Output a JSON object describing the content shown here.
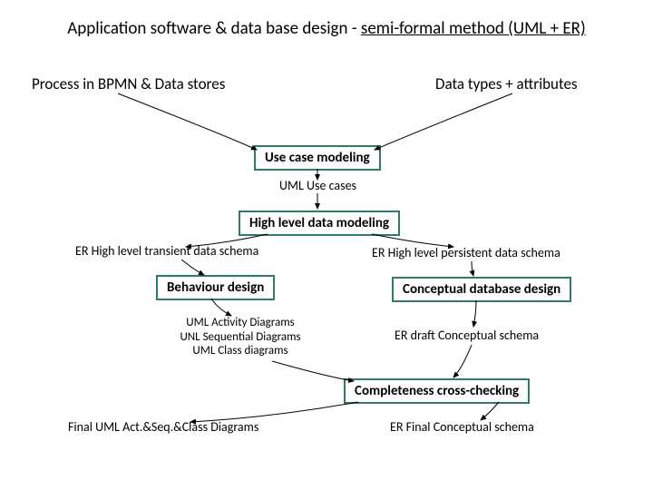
{
  "title_plain": "Application software & data base design - ",
  "title_underline": "semi-formal method (UML + ER)",
  "inputs": {
    "left": "Process in BPMN & Data stores",
    "right": "Data types + attributes"
  },
  "boxes": {
    "usecase": "Use case modeling",
    "highlevel": "High level data modeling",
    "behaviour": "Behaviour design",
    "conceptual": "Conceptual database design",
    "completeness": "Completeness cross-checking"
  },
  "labels": {
    "uml_usecases": "UML Use cases",
    "er_transient": "ER High level transient data schema",
    "er_persistent": "ER High level persistent data schema",
    "uml_diagrams_l1": "UML Activity Diagrams",
    "uml_diagrams_l2": "UNL Sequential Diagrams",
    "uml_diagrams_l3": "UML Class diagrams",
    "er_draft": "ER draft Conceptual schema",
    "final_uml": "Final UML Act.&Seq.&Class Diagrams",
    "er_final": "ER Final  Conceptual schema"
  }
}
